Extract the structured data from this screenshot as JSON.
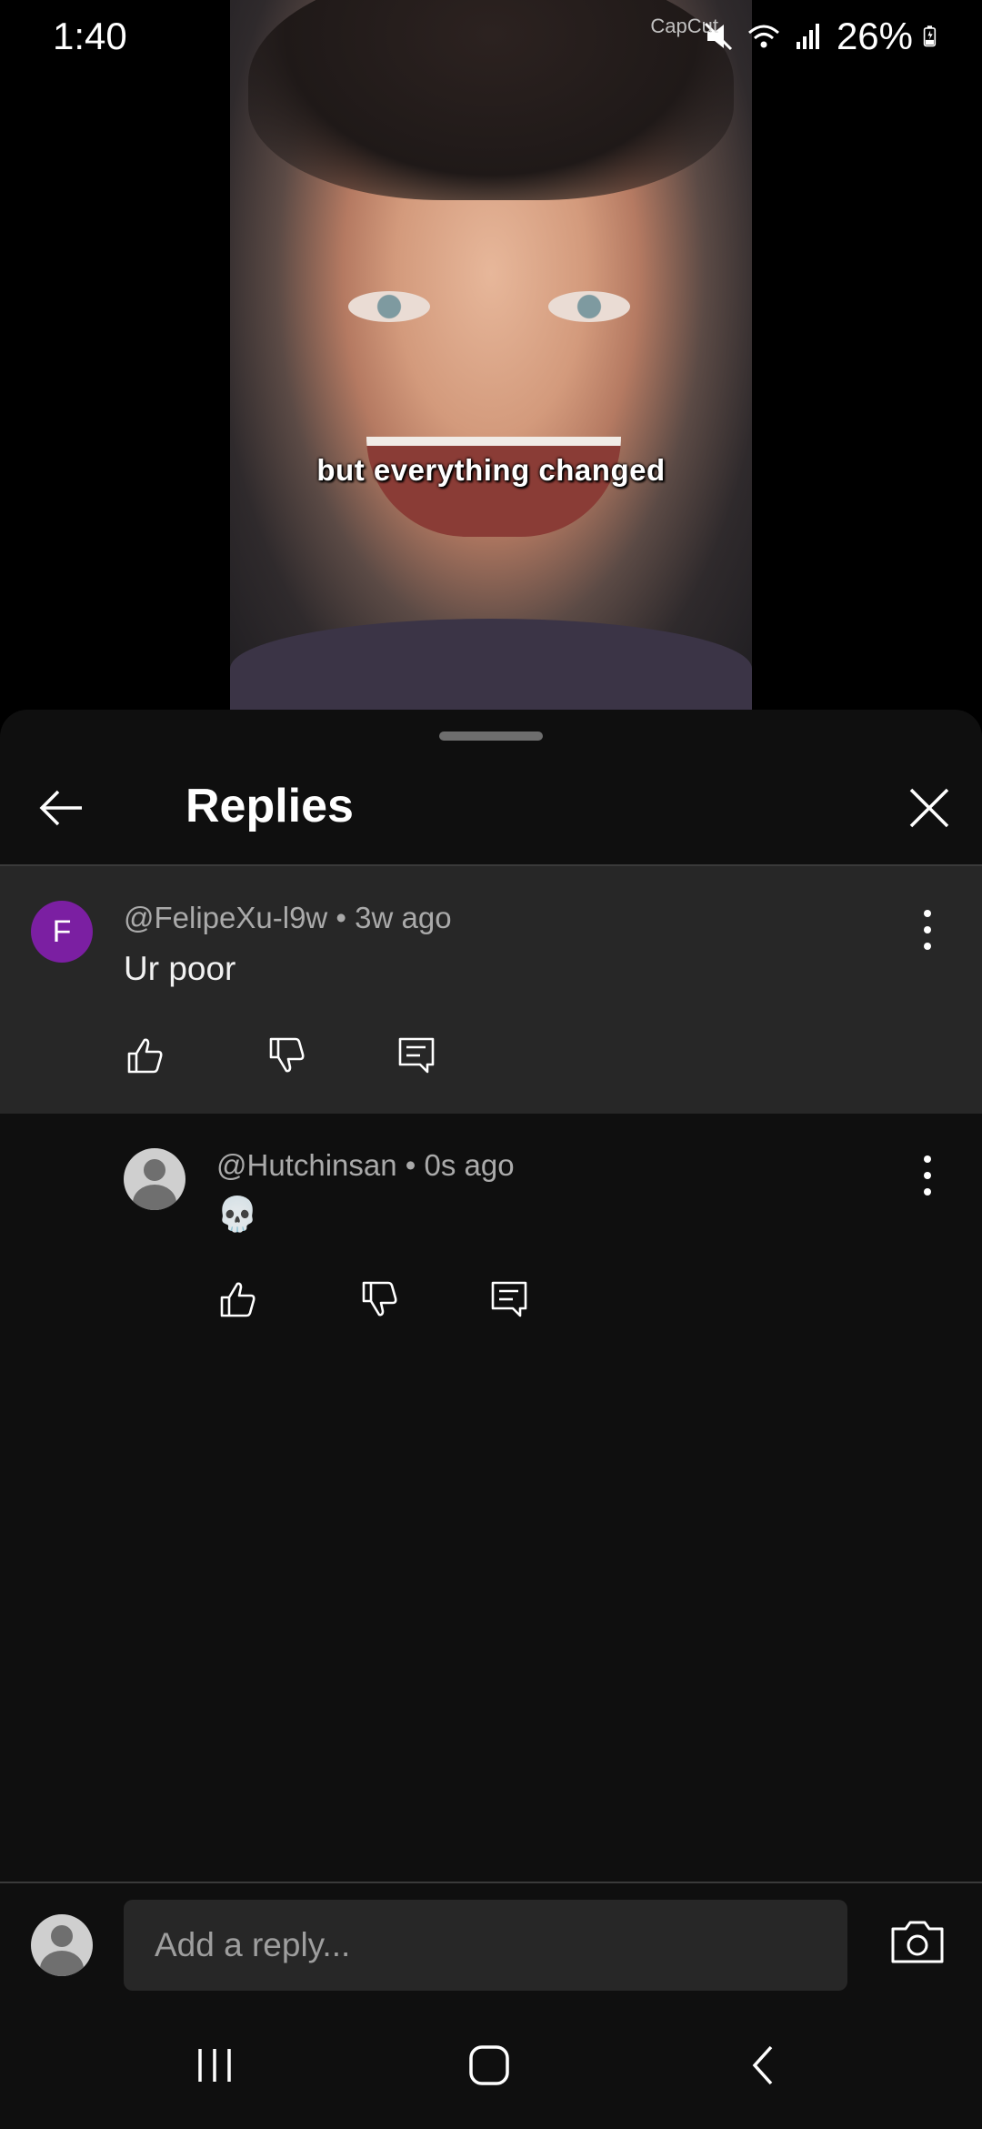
{
  "status_bar": {
    "time": "1:40",
    "watermark": "CapCut",
    "battery_percent": "26%",
    "icons": [
      "mute-icon",
      "wifi-icon",
      "signal-icon",
      "battery-icon"
    ]
  },
  "video": {
    "caption": "but everything changed"
  },
  "sheet": {
    "title": "Replies",
    "back_icon": "arrow-left-icon",
    "close_icon": "close-icon"
  },
  "comments": [
    {
      "avatar_letter": "F",
      "avatar_color": "#7b1fa2",
      "author": "@FelipeXu-l9w",
      "time_ago": "3w ago",
      "meta": "@FelipeXu-l9w • 3w ago",
      "text": "Ur poor"
    },
    {
      "avatar": "default-avatar-icon",
      "author": "@Hutchinsan",
      "time_ago": "0s ago",
      "meta": "@Hutchinsan • 0s ago",
      "text": "💀"
    }
  ],
  "reply_bar": {
    "placeholder": "Add a reply..."
  },
  "colors": {
    "sheet_bg": "#0f0f0f",
    "highlight_bg": "#272727",
    "accent_avatar": "#7b1fa2",
    "secondary_text": "#aaaaaa"
  }
}
